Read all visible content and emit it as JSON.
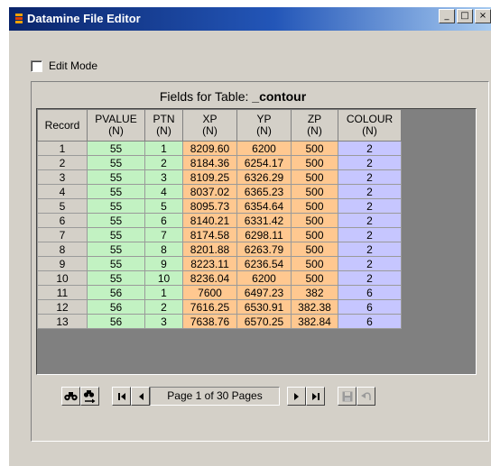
{
  "window": {
    "title": "Datamine File Editor",
    "buttons": {
      "minimize": "_",
      "maximize": "□",
      "close": "×"
    }
  },
  "edit_mode": {
    "label": "Edit Mode",
    "checked": false
  },
  "fields": {
    "prefix": "Fields for Table: ",
    "table_name": "_contour"
  },
  "grid": {
    "columns": [
      {
        "name": "Record",
        "type": ""
      },
      {
        "name": "PVALUE",
        "type": "(N)"
      },
      {
        "name": "PTN",
        "type": "(N)"
      },
      {
        "name": "XP",
        "type": "(N)"
      },
      {
        "name": "YP",
        "type": "(N)"
      },
      {
        "name": "ZP",
        "type": "(N)"
      },
      {
        "name": "COLOUR",
        "type": "(N)"
      }
    ],
    "column_colors": {
      "record": "#d4d0c8",
      "pvalue": "#c2f2c2",
      "ptn": "#c2f2c2",
      "xp": "#ffc890",
      "yp": "#ffc890",
      "zp": "#ffc890",
      "colour": "#c6c6ff"
    },
    "rows": [
      [
        "1",
        "55",
        "1",
        "8209.60",
        "6200",
        "500",
        "2"
      ],
      [
        "2",
        "55",
        "2",
        "8184.36",
        "6254.17",
        "500",
        "2"
      ],
      [
        "3",
        "55",
        "3",
        "8109.25",
        "6326.29",
        "500",
        "2"
      ],
      [
        "4",
        "55",
        "4",
        "8037.02",
        "6365.23",
        "500",
        "2"
      ],
      [
        "5",
        "55",
        "5",
        "8095.73",
        "6354.64",
        "500",
        "2"
      ],
      [
        "6",
        "55",
        "6",
        "8140.21",
        "6331.42",
        "500",
        "2"
      ],
      [
        "7",
        "55",
        "7",
        "8174.58",
        "6298.11",
        "500",
        "2"
      ],
      [
        "8",
        "55",
        "8",
        "8201.88",
        "6263.79",
        "500",
        "2"
      ],
      [
        "9",
        "55",
        "9",
        "8223.11",
        "6236.54",
        "500",
        "2"
      ],
      [
        "10",
        "55",
        "10",
        "8236.04",
        "6200",
        "500",
        "2"
      ],
      [
        "11",
        "56",
        "1",
        "7600",
        "6497.23",
        "382",
        "6"
      ],
      [
        "12",
        "56",
        "2",
        "7616.25",
        "6530.91",
        "382.38",
        "6"
      ],
      [
        "13",
        "56",
        "3",
        "7638.76",
        "6570.25",
        "382.84",
        "6"
      ]
    ]
  },
  "nav": {
    "find_icon": "binoculars-icon",
    "goto_icon": "goto-record-icon",
    "first_icon": "first-page-icon",
    "prev_icon": "previous-page-icon",
    "page_text": "Page 1 of 30 Pages",
    "next_icon": "next-page-icon",
    "last_icon": "last-page-icon",
    "save_icon": "save-icon",
    "undo_icon": "undo-icon"
  }
}
